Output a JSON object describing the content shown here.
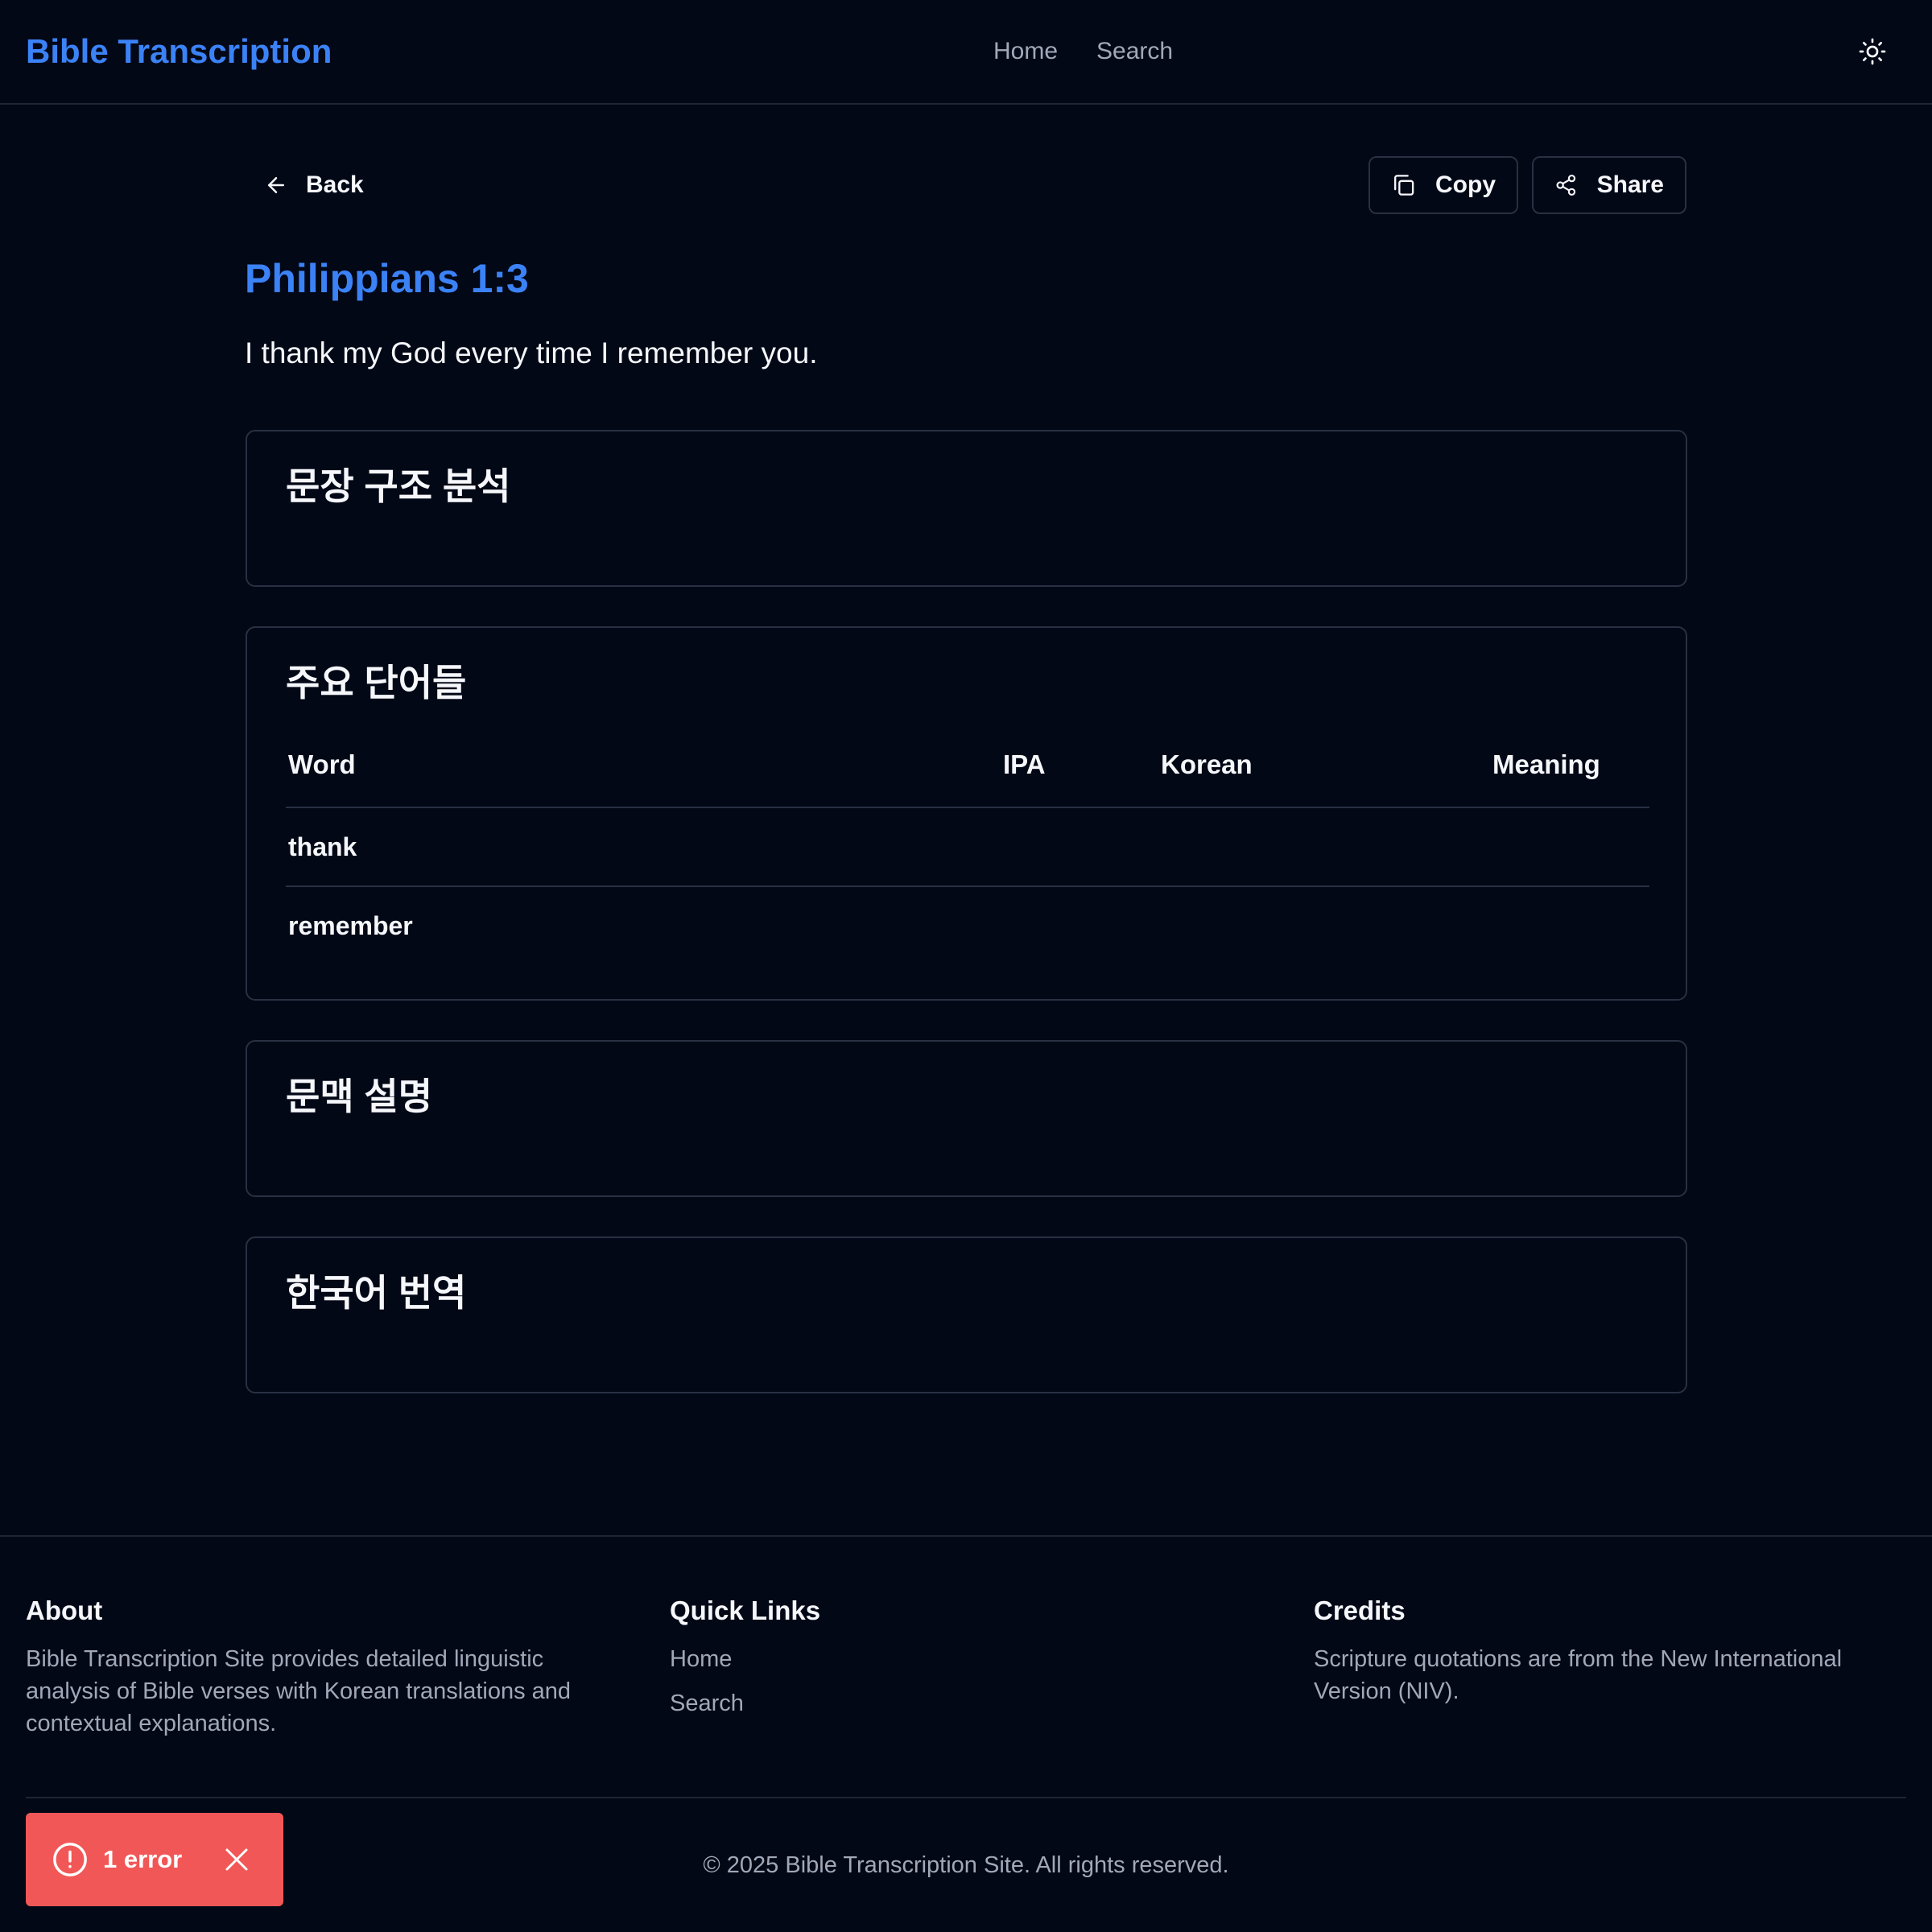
{
  "header": {
    "brand": "Bible Transcription",
    "nav": [
      {
        "label": "Home"
      },
      {
        "label": "Search"
      }
    ],
    "theme_icon": "sun-icon"
  },
  "toolbar": {
    "back_label": "Back",
    "copy_label": "Copy",
    "share_label": "Share"
  },
  "verse": {
    "reference": "Philippians 1:3",
    "text": "I thank my God every time I remember you."
  },
  "sections": {
    "structure_title": "문장 구조 분석",
    "words_title": "주요 단어들",
    "context_title": "문맥 설명",
    "korean_title": "한국어 번역"
  },
  "words_table": {
    "headers": [
      "Word",
      "IPA",
      "Korean",
      "Meaning"
    ],
    "rows": [
      {
        "word": "thank",
        "ipa": "",
        "korean": "",
        "meaning": ""
      },
      {
        "word": "remember",
        "ipa": "",
        "korean": "",
        "meaning": ""
      }
    ]
  },
  "footer": {
    "about_title": "About",
    "about_text": "Bible Transcription Site provides detailed linguistic analysis of Bible verses with Korean translations and contextual explanations.",
    "links_title": "Quick Links",
    "links": [
      {
        "label": "Home"
      },
      {
        "label": "Search"
      }
    ],
    "credits_title": "Credits",
    "credits_text": "Scripture quotations are from the New International Version (NIV).",
    "copyright": "© 2025 Bible Transcription Site. All rights reserved."
  },
  "error_toast": {
    "label": "1 error",
    "color": "#f25757"
  },
  "colors": {
    "background": "#030816",
    "accent": "#3b82f6",
    "border": "#283042",
    "muted_text": "#a1a8b8"
  }
}
